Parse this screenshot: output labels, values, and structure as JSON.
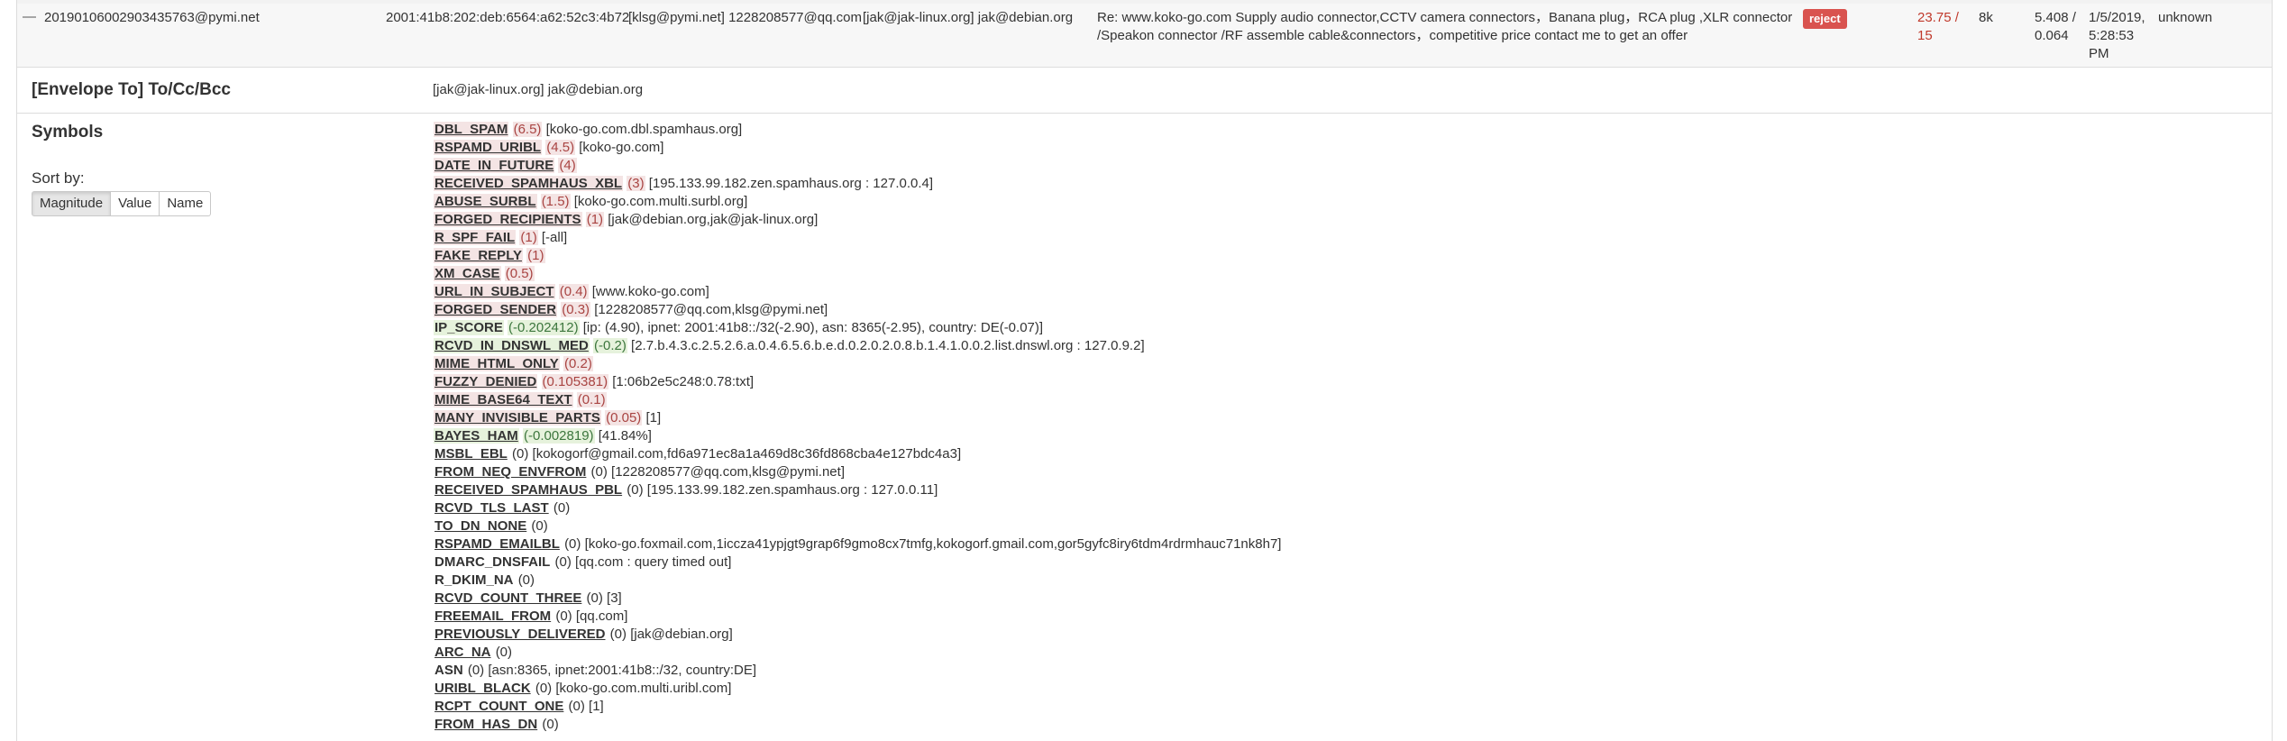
{
  "summary": {
    "message_id": "20190106002903435763@pymi.net",
    "ip": "2001:41b8:202:deb:6564:a62:52c3:4b72",
    "from": "[klsg@pymi.net] 1228208577@qq.com",
    "to": "[jak@jak-linux.org] jak@debian.org",
    "subject": "Re: www.koko-go.com Supply audio connector,CCTV camera connectors，Banana plug，RCA plug ,XLR connector /Speakon connector /RF assemble cable&connectors，competitive price contact me to get an offer",
    "action": "reject",
    "score": "23.75 / 15",
    "size": "8k",
    "scan_time": "5.408 / 0.064",
    "date": "1/5/2019, 5:28:53 PM",
    "user": "unknown"
  },
  "envelope": {
    "label": "[Envelope To] To/Cc/Bcc",
    "value": "[jak@jak-linux.org] jak@debian.org"
  },
  "symbols_section": {
    "label": "Symbols",
    "sort_label": "Sort by:",
    "sort_buttons": [
      "Magnitude",
      "Value",
      "Name"
    ],
    "active_sort": "Magnitude"
  },
  "symbols": [
    {
      "name": "DBL_SPAM",
      "score": "(6.5)",
      "opt": "[koko-go.com.dbl.spamhaus.org]",
      "kind": "pos"
    },
    {
      "name": "RSPAMD_URIBL",
      "score": "(4.5)",
      "opt": "[koko-go.com]",
      "kind": "pos"
    },
    {
      "name": "DATE_IN_FUTURE",
      "score": "(4)",
      "opt": "",
      "kind": "pos"
    },
    {
      "name": "RECEIVED_SPAMHAUS_XBL",
      "score": "(3)",
      "opt": "[195.133.99.182.zen.spamhaus.org : 127.0.0.4]",
      "kind": "pos"
    },
    {
      "name": "ABUSE_SURBL",
      "score": "(1.5)",
      "opt": "[koko-go.com.multi.surbl.org]",
      "kind": "pos"
    },
    {
      "name": "FORGED_RECIPIENTS",
      "score": "(1)",
      "opt": "[jak@debian.org,jak@jak-linux.org]",
      "kind": "pos"
    },
    {
      "name": "R_SPF_FAIL",
      "score": "(1)",
      "opt": "[-all]",
      "kind": "pos"
    },
    {
      "name": "FAKE_REPLY",
      "score": "(1)",
      "opt": "",
      "kind": "pos"
    },
    {
      "name": "XM_CASE",
      "score": "(0.5)",
      "opt": "",
      "kind": "pos"
    },
    {
      "name": "URL_IN_SUBJECT",
      "score": "(0.4)",
      "opt": "[www.koko-go.com]",
      "kind": "pos"
    },
    {
      "name": "FORGED_SENDER",
      "score": "(0.3)",
      "opt": "[1228208577@qq.com,klsg@pymi.net]",
      "kind": "pos"
    },
    {
      "name": "IP_SCORE",
      "score": "(-0.202412)",
      "opt": "[ip: (4.90), ipnet: 2001:41b8::/32(-2.90), asn: 8365(-2.95), country: DE(-0.07)]",
      "kind": "neg nou"
    },
    {
      "name": "RCVD_IN_DNSWL_MED",
      "score": "(-0.2)",
      "opt": "[2.7.b.4.3.c.2.5.2.6.a.0.4.6.5.6.b.e.d.0.2.0.2.0.8.b.1.4.1.0.0.2.list.dnswl.org : 127.0.9.2]",
      "kind": "neg"
    },
    {
      "name": "MIME_HTML_ONLY",
      "score": "(0.2)",
      "opt": "",
      "kind": "pos"
    },
    {
      "name": "FUZZY_DENIED",
      "score": "(0.105381)",
      "opt": "[1:06b2e5c248:0.78:txt]",
      "kind": "pos"
    },
    {
      "name": "MIME_BASE64_TEXT",
      "score": "(0.1)",
      "opt": "",
      "kind": "pos"
    },
    {
      "name": "MANY_INVISIBLE_PARTS",
      "score": "(0.05)",
      "opt": "[1]",
      "kind": "pos"
    },
    {
      "name": "BAYES_HAM",
      "score": "(-0.002819)",
      "opt": "[41.84%]",
      "kind": "neg"
    },
    {
      "name": "MSBL_EBL",
      "score": "(0)",
      "opt": "[kokogorf@gmail.com,fd6a971ec8a1a469d8c36fd868cba4e127bdc4a3]",
      "kind": "zero"
    },
    {
      "name": "FROM_NEQ_ENVFROM",
      "score": "(0)",
      "opt": "[1228208577@qq.com,klsg@pymi.net]",
      "kind": "zero"
    },
    {
      "name": "RECEIVED_SPAMHAUS_PBL",
      "score": "(0)",
      "opt": "[195.133.99.182.zen.spamhaus.org : 127.0.0.11]",
      "kind": "zero"
    },
    {
      "name": "RCVD_TLS_LAST",
      "score": "(0)",
      "opt": "",
      "kind": "zero"
    },
    {
      "name": "TO_DN_NONE",
      "score": "(0)",
      "opt": "",
      "kind": "zero"
    },
    {
      "name": "RSPAMD_EMAILBL",
      "score": "(0)",
      "opt": "[koko-go.foxmail.com,1iccza41ypjgt9grap6f9gmo8cx7tmfg,kokogorf.gmail.com,gor5gyfc8iry6tdm4rdrmhauc71nk8h7]",
      "kind": "zero"
    },
    {
      "name": "DMARC_DNSFAIL",
      "score": "(0)",
      "opt": "[qq.com : query timed out]",
      "kind": "zero nou"
    },
    {
      "name": "R_DKIM_NA",
      "score": "(0)",
      "opt": "",
      "kind": "zero nou"
    },
    {
      "name": "RCVD_COUNT_THREE",
      "score": "(0)",
      "opt": "[3]",
      "kind": "zero"
    },
    {
      "name": "FREEMAIL_FROM",
      "score": "(0)",
      "opt": "[qq.com]",
      "kind": "zero"
    },
    {
      "name": "PREVIOUSLY_DELIVERED",
      "score": "(0)",
      "opt": "[jak@debian.org]",
      "kind": "zero"
    },
    {
      "name": "ARC_NA",
      "score": "(0)",
      "opt": "",
      "kind": "zero"
    },
    {
      "name": "ASN",
      "score": "(0)",
      "opt": "[asn:8365, ipnet:2001:41b8::/32, country:DE]",
      "kind": "zero nou"
    },
    {
      "name": "URIBL_BLACK",
      "score": "(0)",
      "opt": "[koko-go.com.multi.uribl.com]",
      "kind": "zero"
    },
    {
      "name": "RCPT_COUNT_ONE",
      "score": "(0)",
      "opt": "[1]",
      "kind": "zero"
    },
    {
      "name": "FROM_HAS_DN",
      "score": "(0)",
      "opt": "",
      "kind": "zero"
    }
  ]
}
